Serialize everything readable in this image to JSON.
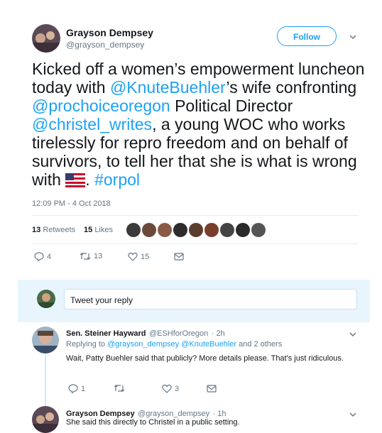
{
  "main_tweet": {
    "author_name": "Grayson Dempsey",
    "author_handle": "@grayson_dempsey",
    "follow_label": "Follow",
    "text": {
      "p1": "Kicked off a women’s empowerment luncheon today with ",
      "m1": "@KnuteBuehler",
      "p2": "’s wife confronting ",
      "m2": "@prochoiceoregon",
      "p3": " Political Director ",
      "m3": "@christel_writes",
      "p4": ", a young WOC who works tirelessly for repro freedom and on behalf of survivors, to tell her that she is what is wrong with ",
      "p5": ". ",
      "h1": "#orpol"
    },
    "timestamp": "12:09 PM - 4 Oct 2018",
    "retweets_count": "13",
    "retweets_label": "Retweets",
    "likes_count": "15",
    "likes_label": "Likes",
    "actions": {
      "replies": "4",
      "retweets": "13",
      "likes": "15"
    }
  },
  "reply_composer": {
    "placeholder": "Tweet your reply"
  },
  "replies": [
    {
      "author_name": "Sen. Steiner Hayward",
      "author_handle": "@ESHforOregon",
      "time": "· 2h",
      "replying_prefix": "Replying to ",
      "replying_to": "@grayson_dempsey @KnuteBuehler",
      "replying_suffix": " and 2 others",
      "text": "Wait, Patty Buehler said that publicly? More details please. That's just ridiculous.",
      "actions": {
        "replies": "1",
        "retweets": "",
        "likes": "3"
      }
    },
    {
      "author_name": "Grayson Dempsey",
      "author_handle": "@grayson_dempsey",
      "time": "· 1h",
      "text": "She said this directly to Christel in a public setting."
    }
  ],
  "colors": {
    "accent": "#1da1f2",
    "text": "#14171a",
    "muted": "#657786",
    "reply_bg": "#e8f5fd"
  },
  "likers": [
    "#3a3a3a",
    "#6b4a3a",
    "#8a5a44",
    "#2d2d2d",
    "#5a3d2b",
    "#7a3e2e",
    "#444444",
    "#2a2a2a",
    "#555555"
  ]
}
